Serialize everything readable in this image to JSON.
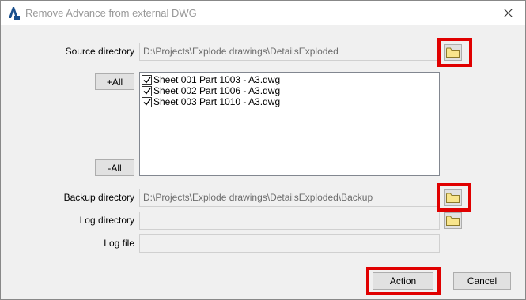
{
  "window": {
    "title": "Remove Advance from external DWG",
    "close_glyph": "close-icon"
  },
  "source": {
    "label": "Source directory",
    "value": "D:\\Projects\\Explode drawings\\DetailsExploded"
  },
  "list": {
    "add_all_label": "+All",
    "remove_all_label": "-All",
    "items": [
      {
        "label": "Sheet 001 Part 1003 - A3.dwg",
        "checked": true
      },
      {
        "label": "Sheet 002 Part 1006 - A3.dwg",
        "checked": true
      },
      {
        "label": "Sheet 003 Part 1010 - A3.dwg",
        "checked": true
      }
    ]
  },
  "backup": {
    "label": "Backup directory",
    "value": "D:\\Projects\\Explode drawings\\DetailsExploded\\Backup"
  },
  "log_dir": {
    "label": "Log directory",
    "value": ""
  },
  "log_file": {
    "label": "Log file",
    "value": ""
  },
  "buttons": {
    "action_label": "Action",
    "cancel_label": "Cancel"
  },
  "colors": {
    "highlight": "#e00000",
    "folder": "#f8e58c"
  }
}
